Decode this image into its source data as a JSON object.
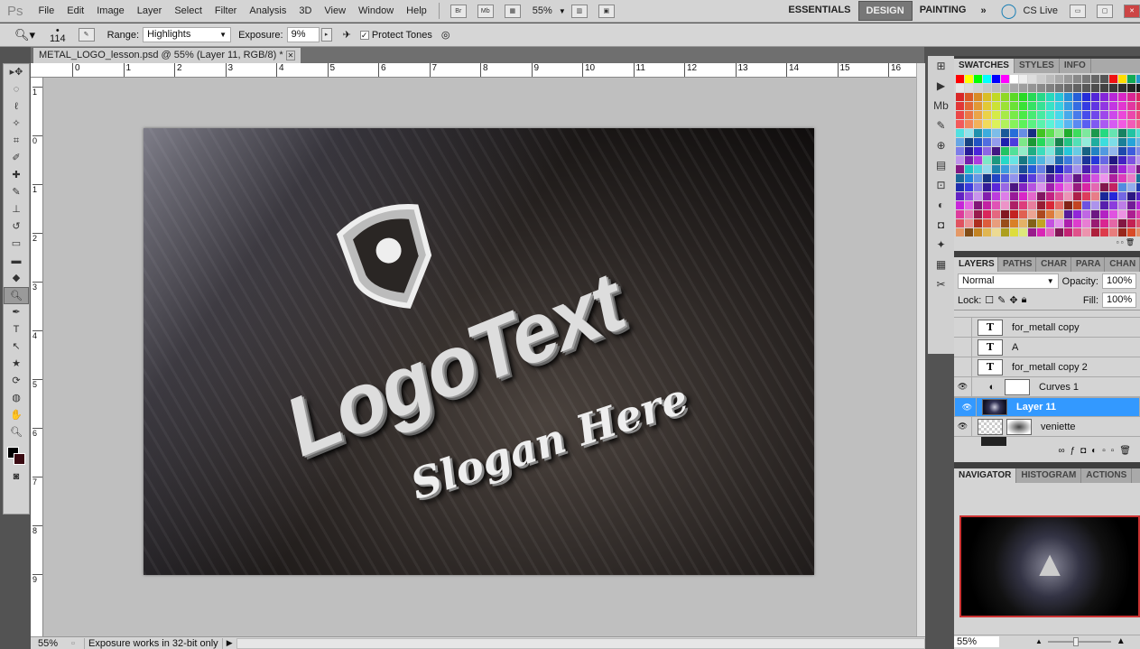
{
  "app": {
    "logo": "Ps",
    "menu": [
      "File",
      "Edit",
      "Image",
      "Layer",
      "Select",
      "Filter",
      "Analysis",
      "3D",
      "View",
      "Window",
      "Help"
    ],
    "bridge": "Br",
    "minibridge": "Mb",
    "zoom": "55%",
    "workspaces": [
      "ESSENTIALS",
      "DESIGN",
      "PAINTING"
    ],
    "active_workspace": "DESIGN",
    "more": "»",
    "cslive": "CS Live"
  },
  "options": {
    "brush_size": "114",
    "range_label": "Range:",
    "range_value": "Highlights",
    "exposure_label": "Exposure:",
    "exposure_value": "9%",
    "protect_tones": "Protect Tones",
    "protect_tones_checked": true
  },
  "document": {
    "tab_title": "METAL_LOGO_lesson.psd @ 55% (Layer 11, RGB/8) *",
    "logo_text": "LogoText",
    "slogan": "Slogan Here"
  },
  "rulers": {
    "h": [
      "0",
      "1",
      "2",
      "3",
      "4",
      "5",
      "6",
      "7",
      "8",
      "9",
      "10",
      "11",
      "12",
      "13",
      "14",
      "15",
      "16"
    ],
    "v": [
      "1",
      "0",
      "1",
      "2",
      "3",
      "4",
      "5",
      "6",
      "7",
      "8",
      "9"
    ]
  },
  "status": {
    "zoom": "55%",
    "message": "Exposure works in 32-bit only"
  },
  "swatches_panel": {
    "tabs": [
      "SWATCHES",
      "STYLES",
      "INFO"
    ]
  },
  "layers_panel": {
    "tabs": [
      "LAYERS",
      "PATHS",
      "CHAR",
      "PARA",
      "CHAN"
    ],
    "blend_mode": "Normal",
    "opacity_label": "Opacity:",
    "opacity": "100%",
    "lock_label": "Lock:",
    "fill_label": "Fill:",
    "fill": "100%",
    "layers": [
      {
        "name": "for_metall copy",
        "type": "text",
        "visible": false
      },
      {
        "name": "A",
        "type": "text",
        "visible": false
      },
      {
        "name": "for_metall copy 2",
        "type": "text",
        "visible": false
      },
      {
        "name": "Curves 1",
        "type": "adjustment",
        "visible": true
      },
      {
        "name": "Layer 11",
        "type": "image",
        "visible": true,
        "selected": true
      },
      {
        "name": "veniette",
        "type": "masked",
        "visible": true
      }
    ]
  },
  "navigator_panel": {
    "tabs": [
      "NAVIGATOR",
      "HISTOGRAM",
      "ACTIONS"
    ],
    "zoom": "55%"
  },
  "colors": {
    "selection": "#3399ff",
    "active_workspace": "#777777"
  }
}
